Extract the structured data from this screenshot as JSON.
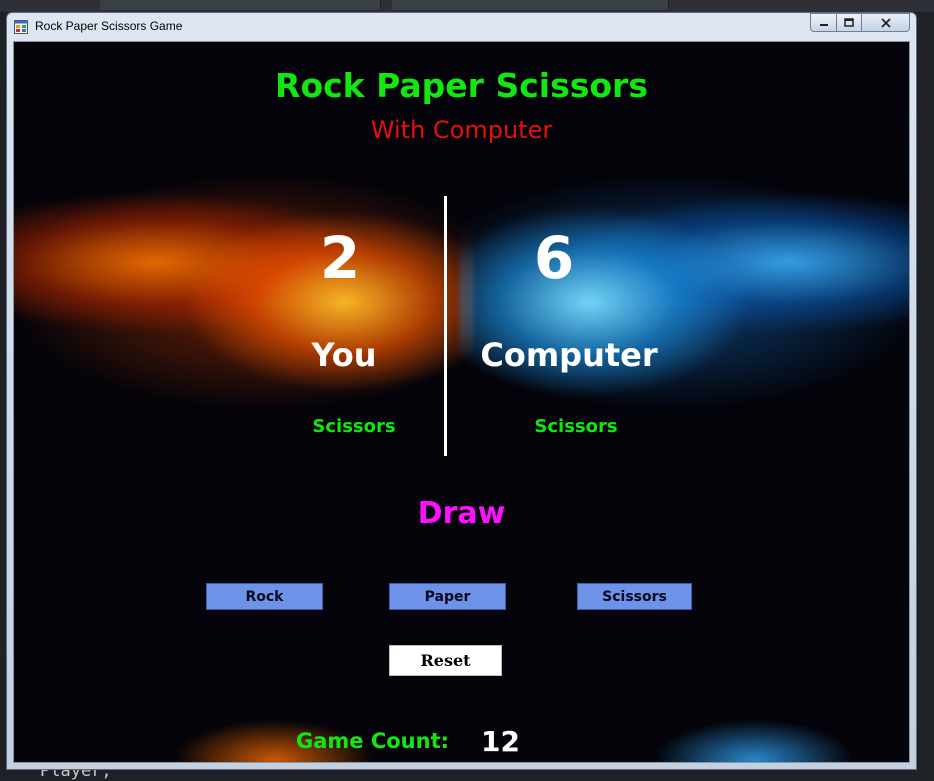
{
  "window": {
    "title": "Rock Paper Scissors Game",
    "controls": {
      "minimize": "▁",
      "maximize": "□",
      "close": "✕"
    }
  },
  "header": {
    "title": "Rock Paper Scissors",
    "subtitle": "With Computer"
  },
  "scoreboard": {
    "player": {
      "score": "2",
      "label": "You",
      "choice": "Scissors"
    },
    "computer": {
      "score": "6",
      "label": "Computer",
      "choice": "Scissors"
    }
  },
  "result": "Draw",
  "moves": {
    "rock_label": "Rock",
    "paper_label": "Paper",
    "scissors_label": "Scissors"
  },
  "reset_label": "Reset",
  "game_count": {
    "label": "Game Count:",
    "value": "12"
  },
  "ide_background_text": "Player;",
  "colors": {
    "title_green": "#13e613",
    "subtitle_red": "#e31010",
    "result_magenta": "#ff11ff",
    "move_button_blue": "#6d92e8",
    "client_background": "#04040a"
  },
  "icons": {
    "app_icon": "app-window-icon"
  }
}
